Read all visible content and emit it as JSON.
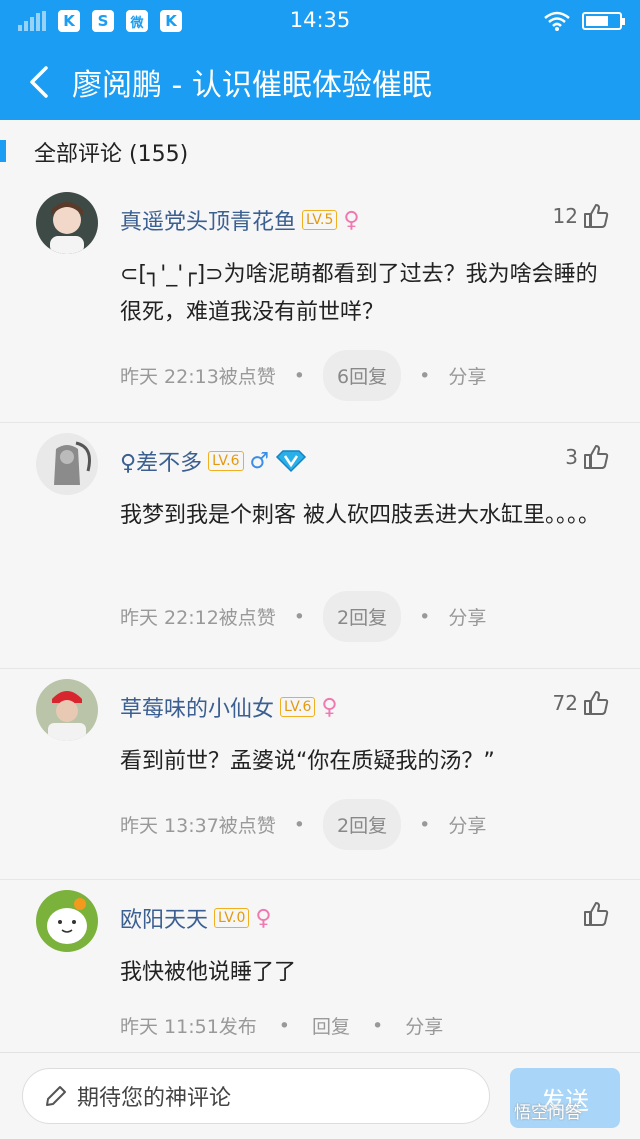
{
  "status": {
    "time": "14:35",
    "app_icons": [
      "K",
      "S",
      "微",
      "K"
    ]
  },
  "header": {
    "title": "廖阅鹏 - 认识催眠体验催眠"
  },
  "section": {
    "label": "全部评论 (155)"
  },
  "comments": [
    {
      "user": "真遥党头顶青花鱼",
      "level": "LV.5",
      "gender": "female",
      "likes": "12",
      "text": "⊂[┐'_'┌]⊃为啥泥萌都看到了过去？我为啥会睡的很死，难道我没有前世咩？",
      "time": "昨天 22:13被点赞",
      "replies": "6回复",
      "share": "分享"
    },
    {
      "user": "♀差不多",
      "level": "LV.6",
      "gender": "male",
      "likes": "3",
      "text": "我梦到我是个刺客 被人砍四肢丢进大水缸里。。。。",
      "time": "昨天 22:12被点赞",
      "replies": "2回复",
      "share": "分享"
    },
    {
      "user": "草莓味的小仙女",
      "level": "LV.6",
      "gender": "female",
      "likes": "72",
      "text": "看到前世？孟婆说“你在质疑我的汤？”",
      "time": "昨天 13:37被点赞",
      "replies": "2回复",
      "share": "分享"
    },
    {
      "user": "欧阳天天",
      "level": "LV.0",
      "gender": "female",
      "likes": "",
      "text": "我快被他说睡了了",
      "time": "昨天 11:51发布",
      "replies": "回复",
      "share": "分享"
    }
  ],
  "footer": {
    "placeholder": "期待您的神评论",
    "send_label": "发送",
    "watermark": "悟空问答"
  },
  "colors": {
    "primary": "#1a9df2",
    "username": "#3b5f91",
    "level_badge": "#f0b020",
    "female": "#f07ab0",
    "male": "#3a8ee6"
  }
}
